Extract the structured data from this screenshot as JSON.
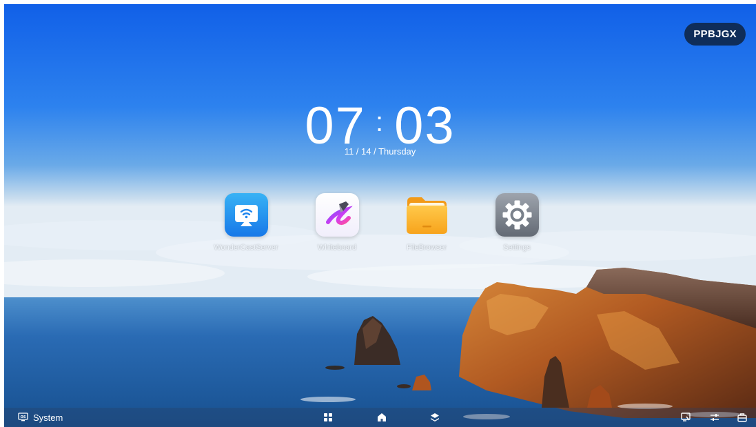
{
  "device_badge": "PPBJGX",
  "clock": {
    "hours": "07",
    "separator": ":",
    "minutes": "03",
    "date": "11 / 14 / Thursday"
  },
  "apps": [
    {
      "label": "WonderCastServer",
      "icon": "cast-icon"
    },
    {
      "label": "Whiteboard",
      "icon": "whiteboard-icon"
    },
    {
      "label": "FileBrowser",
      "icon": "folder-icon"
    },
    {
      "label": "Settings",
      "icon": "gear-icon"
    }
  ],
  "taskbar": {
    "system_label": "System",
    "center_buttons": [
      "apps-grid-icon",
      "home-icon",
      "layers-icon"
    ],
    "right_buttons": [
      "screen-annotate-icon",
      "adjust-icon",
      "toolbox-icon"
    ]
  },
  "colors": {
    "badge_bg": "#0f2d59",
    "sky_top": "#1160e8",
    "sea": "#1c5fae"
  }
}
